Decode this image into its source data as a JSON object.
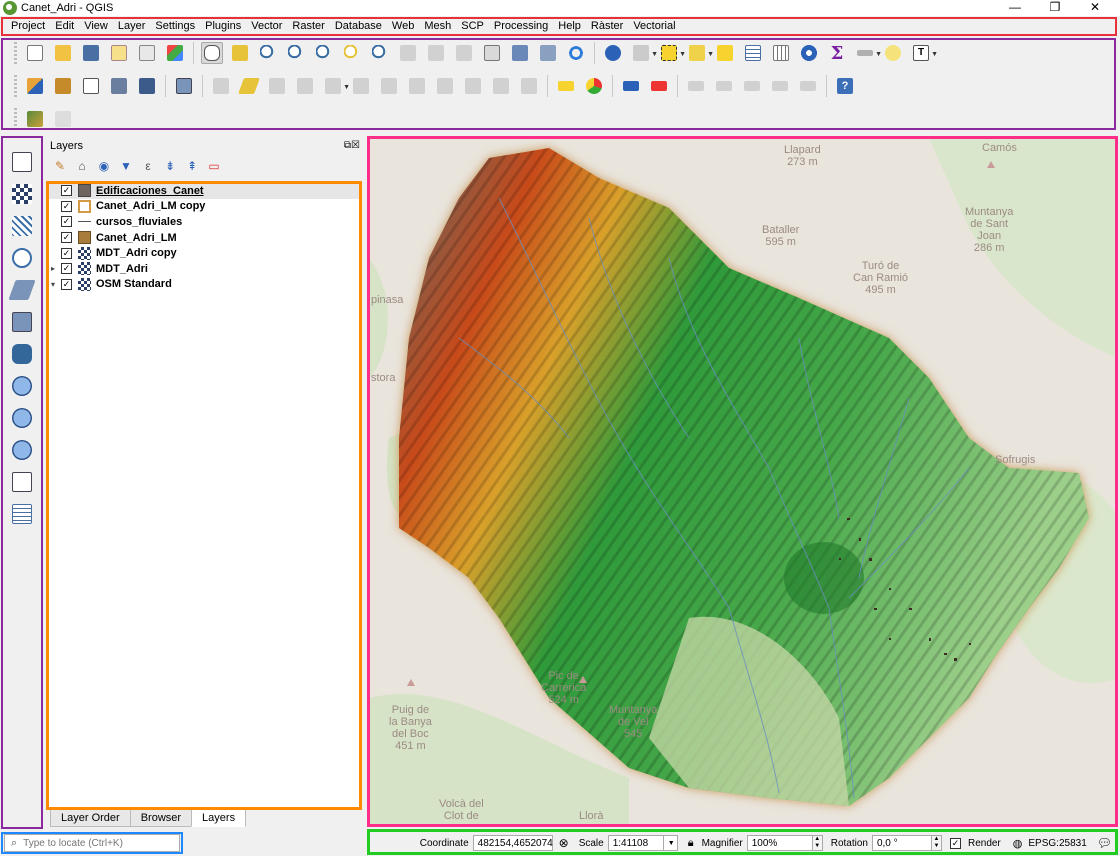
{
  "window": {
    "title": "Canet_Adri - QGIS",
    "minimize": "—",
    "maximize": "❐",
    "close": "✕"
  },
  "menu": [
    "Project",
    "Edit",
    "View",
    "Layer",
    "Settings",
    "Plugins",
    "Vector",
    "Raster",
    "Database",
    "Web",
    "Mesh",
    "SCP",
    "Processing",
    "Help",
    "Ràster",
    "Vectorial"
  ],
  "layers_panel": {
    "title": "Layers",
    "layers": [
      {
        "name": "Edificaciones_Canet",
        "checked": "✓",
        "expand": "",
        "symbol": "#6e6560",
        "selected": true
      },
      {
        "name": "Canet_Adri_LM copy",
        "checked": "✓",
        "expand": "",
        "symbol": "outline-orange"
      },
      {
        "name": "cursos_fluviales",
        "checked": "✓",
        "expand": "",
        "symbol": "line"
      },
      {
        "name": "Canet_Adri_LM",
        "checked": "✓",
        "expand": "",
        "symbol": "#a87c3a"
      },
      {
        "name": "MDT_Adri copy",
        "checked": "✓",
        "expand": "",
        "symbol": "raster"
      },
      {
        "name": "MDT_Adri",
        "checked": "✓",
        "expand": "▸",
        "symbol": "raster"
      },
      {
        "name": "OSM Standard",
        "checked": "✓",
        "expand": "▾",
        "symbol": "raster"
      }
    ],
    "tabs": [
      "Layer Order",
      "Browser",
      "Layers"
    ],
    "active_tab": "Layers"
  },
  "locator": {
    "placeholder": "Type to locate (Ctrl+K)"
  },
  "map_labels": [
    {
      "text": "Llapard\n273 m"
    },
    {
      "text": "Camós"
    },
    {
      "text": "Muntanya\nde Sant\nJoan\n286 m"
    },
    {
      "text": "Bataller\n595 m"
    },
    {
      "text": "Turó de\nCan Ramió\n495 m"
    },
    {
      "text": "pinasa"
    },
    {
      "text": "stora"
    },
    {
      "text": "Pic de\nCarrerica\n524 m"
    },
    {
      "text": "Puig de\nla Banya\ndel Boc\n451 m"
    },
    {
      "text": "Muntanya\nde Vel\n545"
    },
    {
      "text": "Volcà del\nClot de"
    },
    {
      "text": "Llorà"
    },
    {
      "text": "Sofrugis"
    }
  ],
  "statusbar": {
    "coordinate_label": "Coordinate",
    "coordinate": "482154,4652074",
    "scale_label": "Scale",
    "scale": "1:41108",
    "magnifier_label": "Magnifier",
    "magnifier": "100%",
    "rotation_label": "Rotation",
    "rotation": "0,0 °",
    "render_label": "Render",
    "render_checked": "✓",
    "crs": "EPSG:25831"
  },
  "highlight_colors": {
    "menu": "#e8303a",
    "toolbar": "#8a2a9e",
    "panel": "#ff8a00",
    "map": "#ff2d8a",
    "locator": "#1e88ff",
    "status": "#22cc22"
  }
}
